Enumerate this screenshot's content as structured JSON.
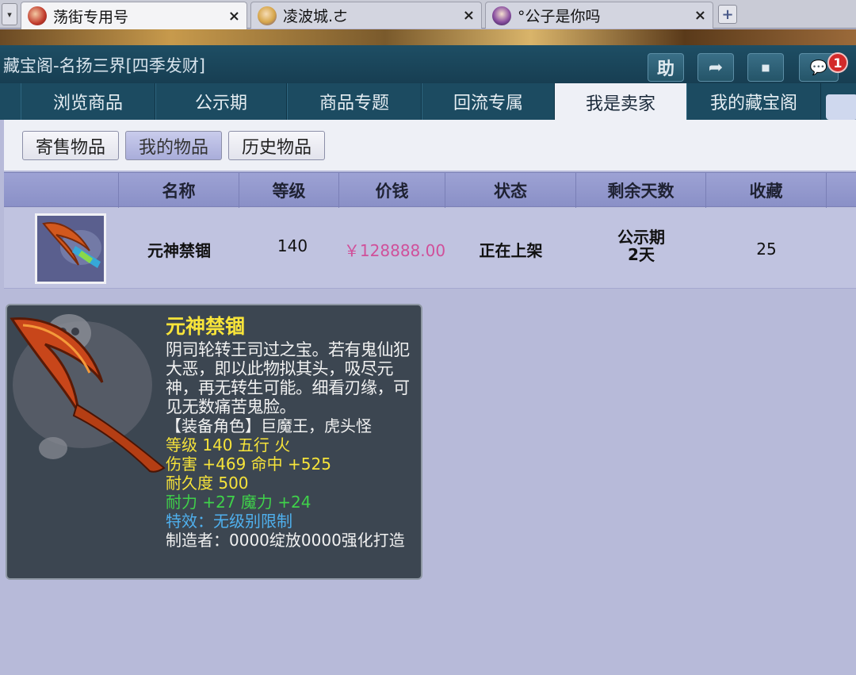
{
  "browser_tabs": [
    {
      "label": "荡街专用号",
      "close": "×",
      "active": true
    },
    {
      "label": "凌波城.ㄜ",
      "close": "×",
      "active": false
    },
    {
      "label": "°公子是你吗",
      "close": "×",
      "active": false
    }
  ],
  "tab_plus": "+",
  "tab_dropdown": "▾",
  "window": {
    "title": "藏宝阁-名扬三界[四季发财]",
    "buttons": {
      "help": "助",
      "share": "➦",
      "stop": "⏹",
      "chat": "💬"
    },
    "notification_count": "1"
  },
  "main_nav": [
    {
      "label": "浏览商品"
    },
    {
      "label": "公示期"
    },
    {
      "label": "商品专题"
    },
    {
      "label": "回流专属"
    },
    {
      "label": "我是卖家",
      "active": true
    },
    {
      "label": "我的藏宝阁"
    }
  ],
  "sub_tabs": [
    {
      "label": "寄售物品"
    },
    {
      "label": "我的物品",
      "active": true
    },
    {
      "label": "历史物品"
    }
  ],
  "table": {
    "headers": [
      "名称",
      "等级",
      "价钱",
      "状态",
      "剩余天数",
      "收藏"
    ],
    "row": {
      "name": "元神禁锢",
      "level": "140",
      "price": "￥128888.00",
      "status": "正在上架",
      "remaining_line1": "公示期",
      "remaining_line2": "2天",
      "favorites": "25"
    }
  },
  "tooltip": {
    "name": "元神禁锢",
    "description": "阴司轮转王司过之宝。若有鬼仙犯大恶，即以此物拟其头，吸尽元神，再无转生可能。细看刃缘，可见无数痛苦鬼脸。",
    "equip_roles": "【装备角色】巨魔王，虎头怪",
    "level_line": "等级 140  五行 火",
    "damage_line": "伤害 +469 命中 +525",
    "durability_line": "耐久度 500",
    "stats_line": "耐力 +27 魔力 +24",
    "effect_line": "特效：无级别限制",
    "maker_line": "制造者：0000绽放0000强化打造"
  },
  "colors": {
    "price": "#d0509a",
    "item_name": "#f8e43a",
    "stat_yellow": "#f6e33a",
    "stat_green": "#3fd14a",
    "effect_blue": "#4fb0ee",
    "header_bg": "#1c4b61"
  },
  "icons": [
    "chevron-down-icon",
    "close-icon",
    "plus-icon",
    "help-icon",
    "share-icon",
    "stop-icon",
    "chat-icon"
  ]
}
